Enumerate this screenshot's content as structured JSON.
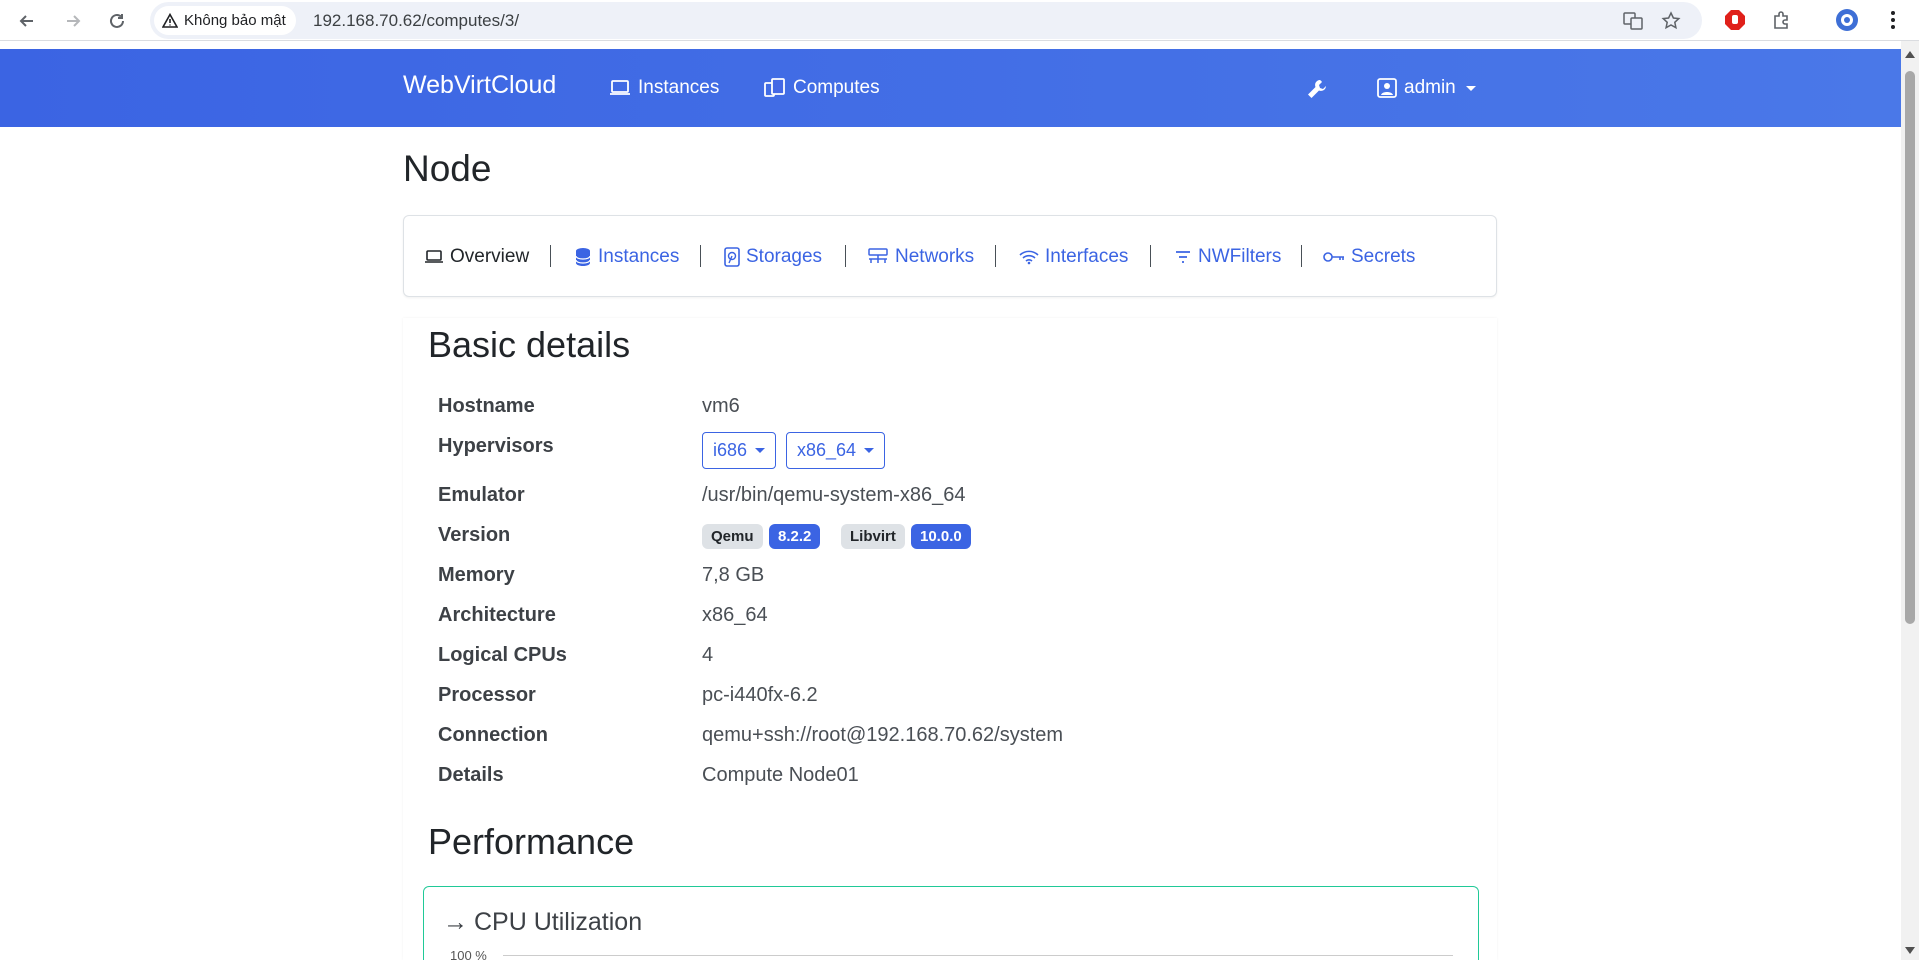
{
  "browser": {
    "security_label": "Không bảo mật",
    "url": "192.168.70.62/computes/3/"
  },
  "navbar": {
    "brand": "WebVirtCloud",
    "instances": "Instances",
    "computes": "Computes",
    "user": "admin"
  },
  "page": {
    "title": "Node"
  },
  "tabs": [
    {
      "label": "Overview",
      "icon": "laptop-icon",
      "active": true
    },
    {
      "label": "Instances",
      "icon": "database-icon",
      "active": false
    },
    {
      "label": "Storages",
      "icon": "hdd-icon",
      "active": false
    },
    {
      "label": "Networks",
      "icon": "network-icon",
      "active": false
    },
    {
      "label": "Interfaces",
      "icon": "wifi-icon",
      "active": false
    },
    {
      "label": "NWFilters",
      "icon": "filter-icon",
      "active": false
    },
    {
      "label": "Secrets",
      "icon": "key-icon",
      "active": false
    }
  ],
  "basic_details": {
    "title": "Basic details",
    "rows": {
      "hostname": {
        "label": "Hostname",
        "value": "vm6"
      },
      "hypervisors": {
        "label": "Hypervisors",
        "options": [
          "i686",
          "x86_64"
        ]
      },
      "emulator": {
        "label": "Emulator",
        "value": "/usr/bin/qemu-system-x86_64"
      },
      "version": {
        "label": "Version",
        "qemu_label": "Qemu",
        "qemu_version": "8.2.2",
        "libvirt_label": "Libvirt",
        "libvirt_version": "10.0.0"
      },
      "memory": {
        "label": "Memory",
        "value": "7,8 GB"
      },
      "architecture": {
        "label": "Architecture",
        "value": "x86_64"
      },
      "logical_cpus": {
        "label": "Logical CPUs",
        "value": "4"
      },
      "processor": {
        "label": "Processor",
        "value": "pc-i440fx-6.2"
      },
      "connection": {
        "label": "Connection",
        "value": "qemu+ssh://root@192.168.70.62/system"
      },
      "details": {
        "label": "Details",
        "value": "Compute Node01"
      }
    }
  },
  "performance": {
    "title": "Performance",
    "cpu_panel_arrow": "→",
    "cpu_panel_title": "CPU Utilization",
    "y_tick_top": "100 %"
  },
  "colors": {
    "primary": "#3b64e3",
    "navbar_gradient_start": "#3b64e3",
    "navbar_gradient_end": "#4a78e8",
    "panel_border": "#20c997"
  }
}
